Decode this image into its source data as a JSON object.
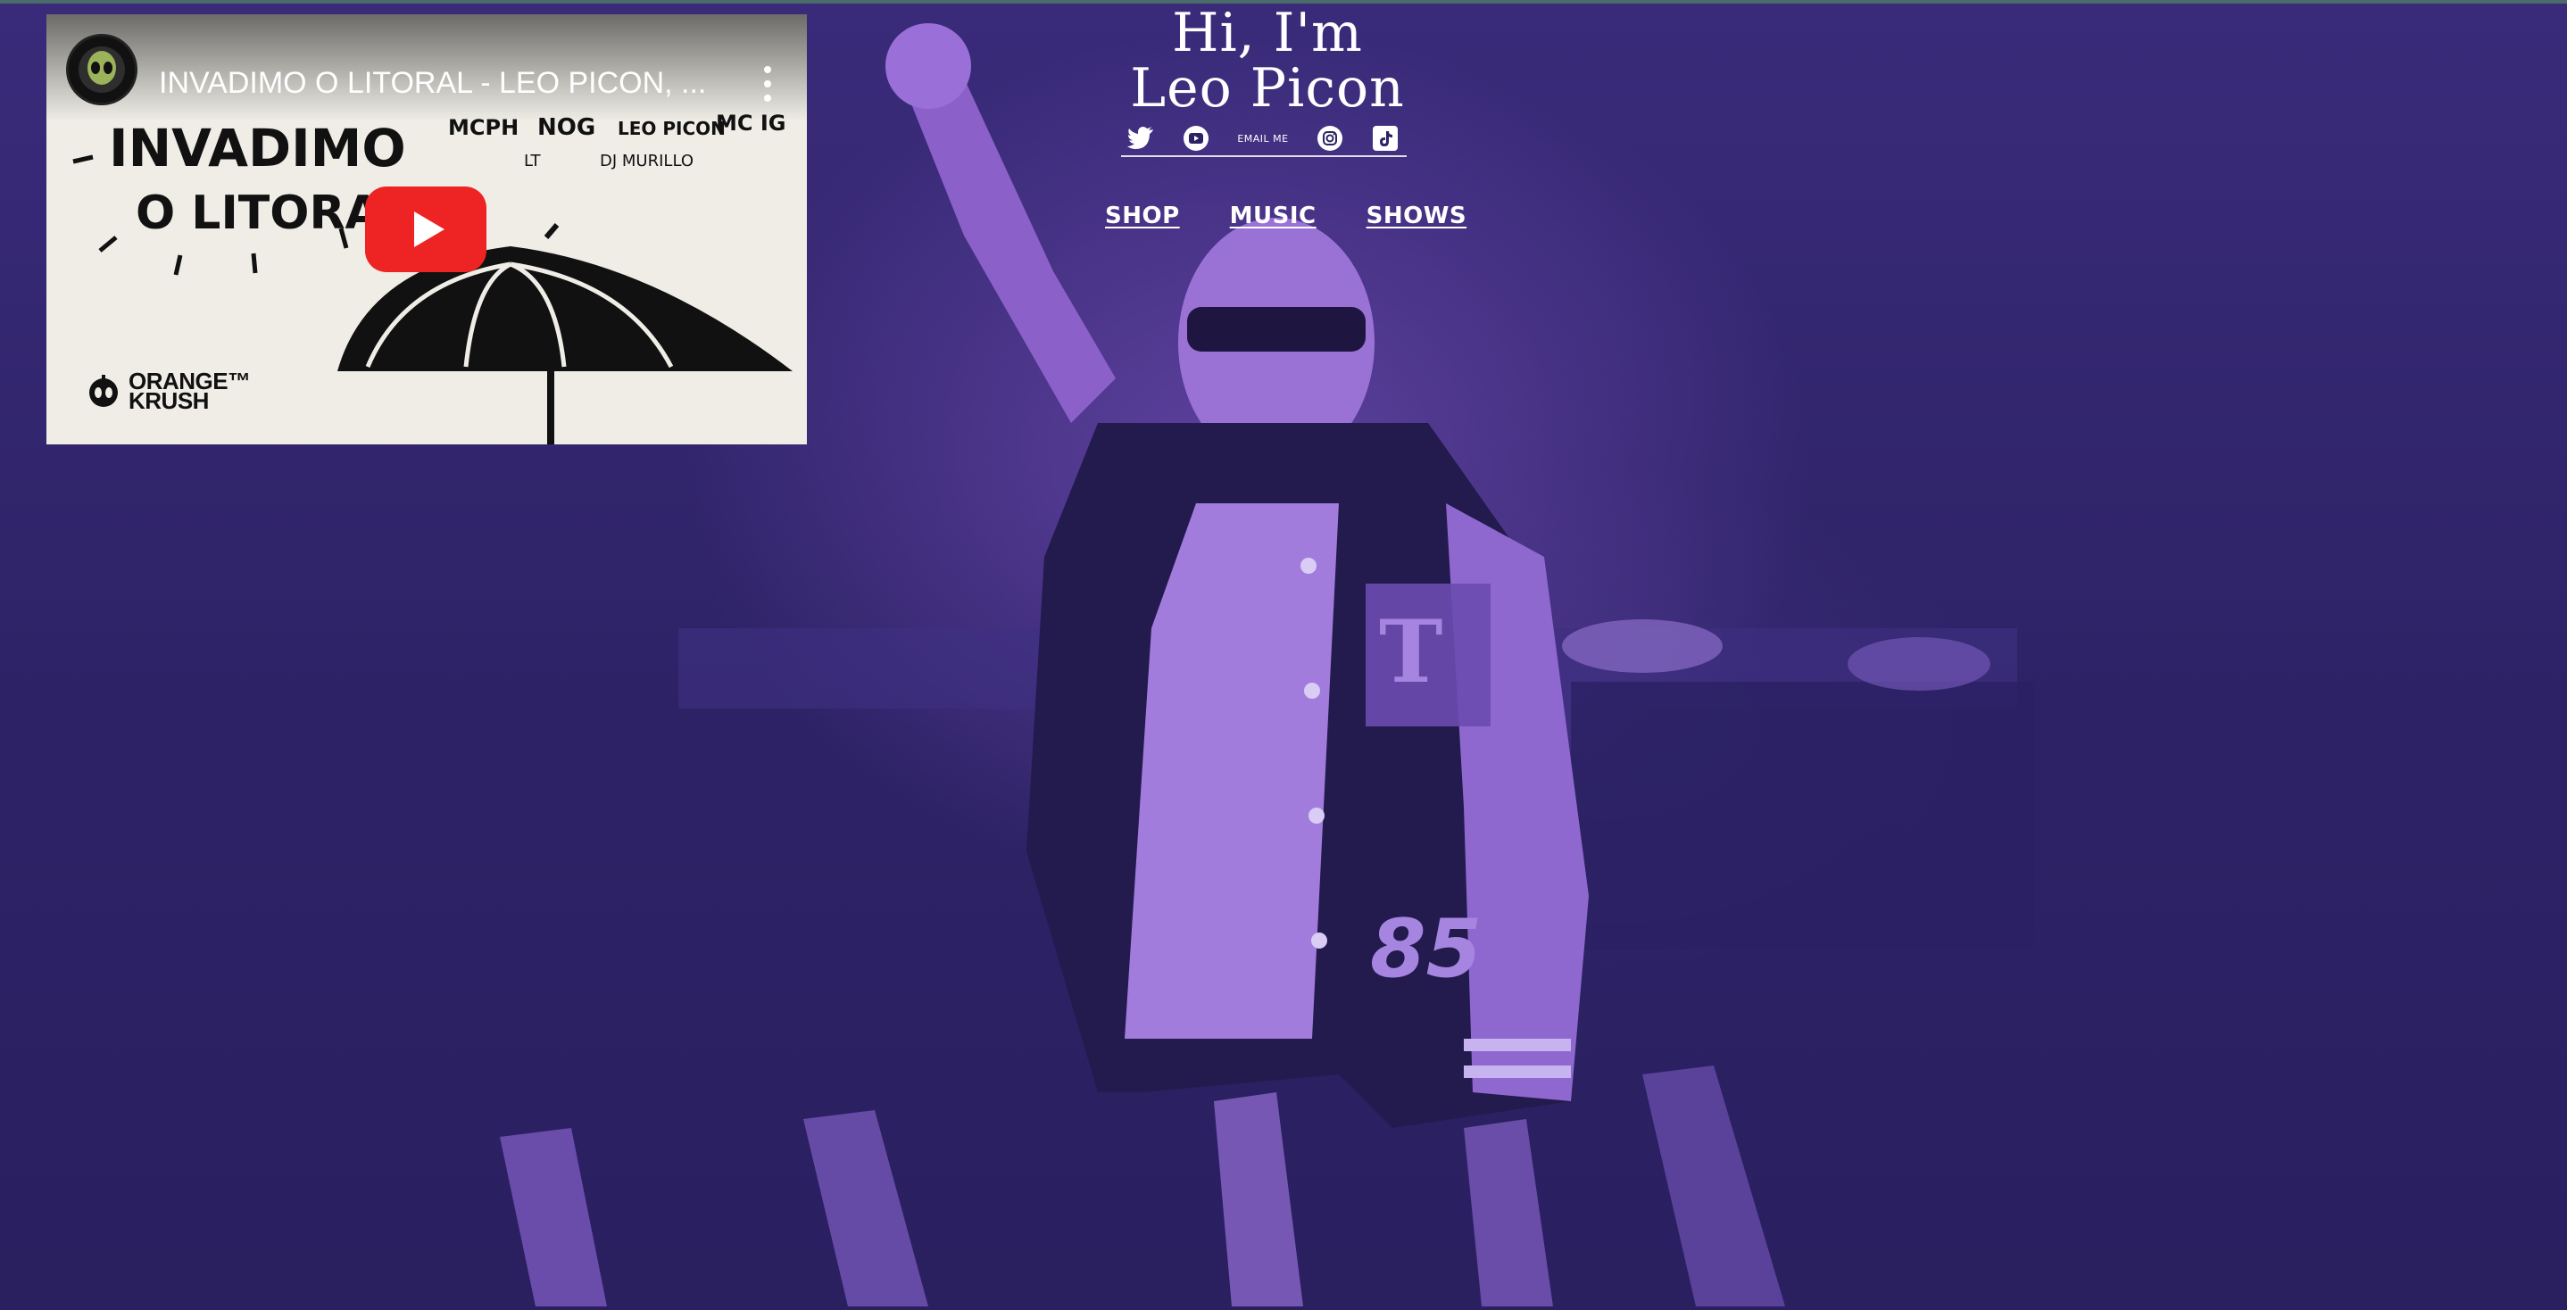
{
  "page": {
    "title_line1": "Hi, I'm",
    "title_line2": "Leo Picon"
  },
  "social": {
    "twitter_icon": "twitter-icon",
    "youtube_icon": "youtube-icon",
    "email_label": "EMAIL ME",
    "instagram_icon": "instagram-icon",
    "tiktok_icon": "tiktok-icon"
  },
  "nav": {
    "items": [
      {
        "label": "SHOP"
      },
      {
        "label": "MUSIC"
      },
      {
        "label": "SHOWS"
      }
    ]
  },
  "video": {
    "title": "INVADIMO O LITORAL - LEO PICON, ...",
    "channel_icon": "alien-avatar-icon",
    "thumbnail_text": {
      "main1": "INVADIMO",
      "main2": "O LITORAL",
      "artists": [
        "MCPH",
        "NOG",
        "LEO PICON",
        "MC IG",
        "LT",
        "DJ MURILLO"
      ],
      "label_line1": "ORANGE™",
      "label_line2": "KRUSH"
    }
  },
  "colors": {
    "background": "#2d2266",
    "accent": "#9b6ad0",
    "play_button": "#ee2323"
  }
}
